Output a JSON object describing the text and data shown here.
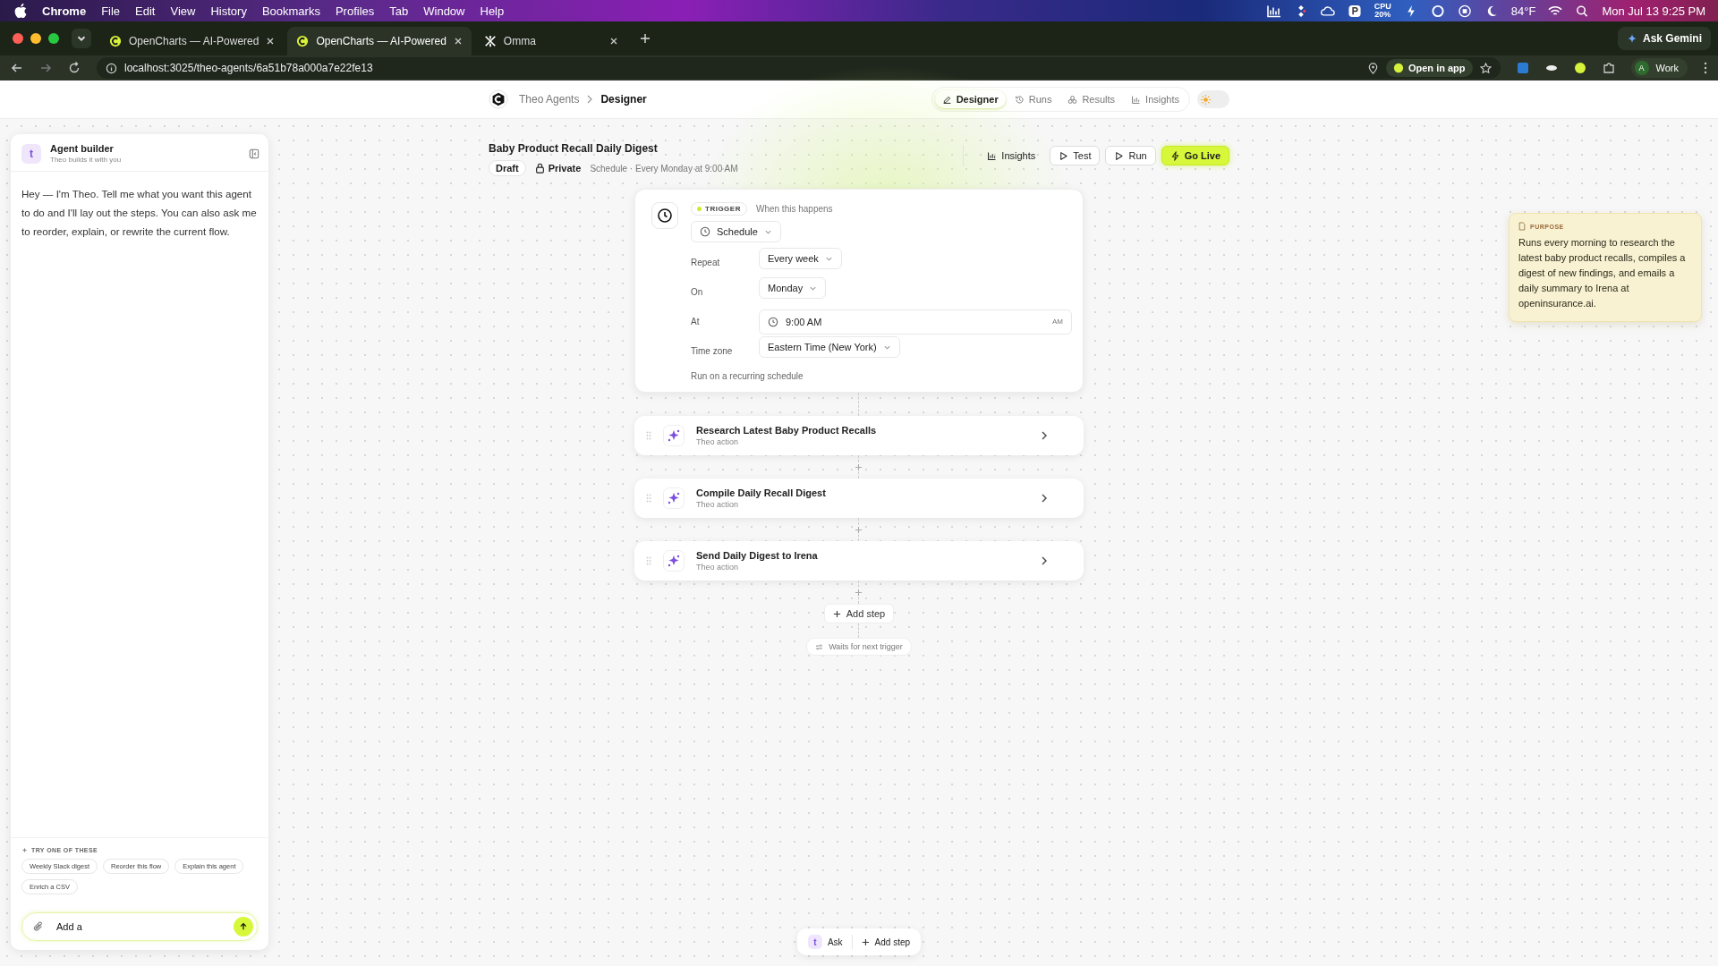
{
  "menu_bar": {
    "app": "Chrome",
    "items": [
      "File",
      "Edit",
      "View",
      "History",
      "Bookmarks",
      "Profiles",
      "Tab",
      "Window",
      "Help"
    ],
    "cpu_label": "CPU",
    "cpu": "20%",
    "weather": "84°F",
    "datetime": "Mon Jul 13  9:25 PM"
  },
  "browser": {
    "tabs": [
      {
        "title": "OpenCharts — AI-Powered",
        "selected": false,
        "kind": "opencharts"
      },
      {
        "title": "OpenCharts — AI-Powered",
        "selected": true,
        "kind": "opencharts"
      },
      {
        "title": "Omma",
        "selected": false,
        "kind": "omma"
      }
    ],
    "ask_gemini": "Ask Gemini",
    "url": "localhost:3025/theo-agents/6a51b78a000a7e22fe13",
    "open_in_app": "Open in app",
    "profile_initial": "A",
    "profile": "Work"
  },
  "header": {
    "breadcrumb": [
      "Theo Agents",
      "Designer"
    ],
    "nav": [
      {
        "label": "Designer",
        "selected": true,
        "kind": "designer"
      },
      {
        "label": "Runs",
        "selected": false,
        "kind": "runs"
      },
      {
        "label": "Results",
        "selected": false,
        "kind": "results"
      },
      {
        "label": "Insights",
        "selected": false,
        "kind": "insights"
      }
    ],
    "theme_toggle": {
      "on": false
    }
  },
  "builder": {
    "avatar": "t",
    "title": "Agent builder",
    "subtitle": "Theo builds it with you",
    "message": "Hey — I'm Theo. Tell me what you want this agent to do and I'll lay out the steps. You can also ask me to reorder, explain, or rewrite the current flow.",
    "suggestions_label": "TRY ONE OF THESE",
    "suggestions": [
      "Weekly Slack digest",
      "Reorder this flow",
      "Explain this agent",
      "Enrich a CSV"
    ],
    "input": {
      "value": "Add a"
    }
  },
  "agent": {
    "title": "Baby Product Recall Daily Digest",
    "status": "Draft",
    "visibility": "Private",
    "schedule": "Schedule · Every Monday at 9:00 AM",
    "actions": [
      {
        "label": "Insights",
        "kind": "plain"
      },
      {
        "label": "Test",
        "kind": "outline"
      },
      {
        "label": "Run",
        "kind": "outline"
      },
      {
        "label": "Go Live",
        "kind": "primary"
      }
    ]
  },
  "trigger": {
    "badge": "TRIGGER",
    "caption": "When this happens",
    "type": "Schedule",
    "fields": [
      {
        "label": "Repeat",
        "value": "Every week",
        "kind": "select"
      },
      {
        "label": "On",
        "value": "Monday",
        "kind": "select"
      },
      {
        "label": "At",
        "value": "9:00 AM",
        "suffix": "AM",
        "kind": "time"
      },
      {
        "label": "Time zone",
        "value": "Eastern Time (New York)",
        "kind": "select"
      }
    ],
    "note": "Run on a recurring schedule"
  },
  "steps": [
    {
      "title": "Research Latest Baby Product Recalls",
      "subtitle": "Theo action"
    },
    {
      "title": "Compile Daily Recall Digest",
      "subtitle": "Theo action"
    },
    {
      "title": "Send Daily Digest to Irena",
      "subtitle": "Theo action"
    }
  ],
  "add_step": "Add step",
  "waits": "Waits for next trigger",
  "purpose": {
    "label": "PURPOSE",
    "text": "Runs every morning to research the latest baby product recalls, compiles a digest of new findings, and emails a daily summary to Irena at openinsurance.ai."
  },
  "bottom_bar": {
    "avatar": "t",
    "ask": "Ask",
    "add_step": "Add step"
  }
}
